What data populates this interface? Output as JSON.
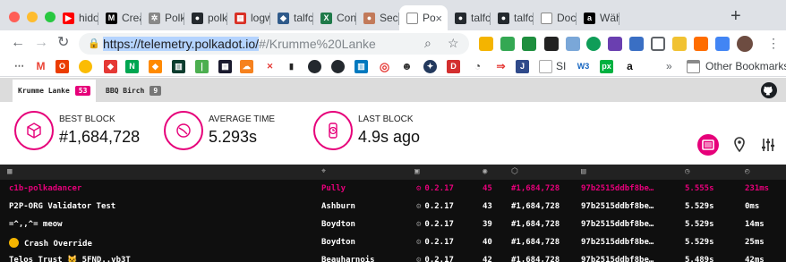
{
  "browser": {
    "tabs": [
      {
        "label": "hidon",
        "favicon": "youtube-icon",
        "color": "#ff0000",
        "glyph": "▶"
      },
      {
        "label": "Creat",
        "favicon": "medium-icon",
        "color": "#000000",
        "glyph": "M"
      },
      {
        "label": "Polka",
        "favicon": "polkadot-icon",
        "color": "#888888",
        "glyph": "✲"
      },
      {
        "label": "polka",
        "favicon": "github-icon",
        "color": "#24292e",
        "glyph": "●"
      },
      {
        "label": "logwa",
        "favicon": "logwatch-icon",
        "color": "#d93025",
        "glyph": "▦"
      },
      {
        "label": "talfco",
        "favicon": "gitlab-icon",
        "color": "#2f5a8a",
        "glyph": "◆"
      },
      {
        "label": "Confi",
        "favicon": "confluence-icon",
        "color": "#1f7a4a",
        "glyph": "X"
      },
      {
        "label": "Secur",
        "favicon": "user-icon",
        "color": "#c27a5a",
        "glyph": "●"
      },
      {
        "label": "Po",
        "favicon": "page-icon",
        "color": "#ffffff",
        "glyph": ""
      },
      {
        "label": "talfco",
        "favicon": "github-icon",
        "color": "#24292e",
        "glyph": "●"
      },
      {
        "label": "talfco",
        "favicon": "github-icon",
        "color": "#24292e",
        "glyph": "●"
      },
      {
        "label": "Dock",
        "favicon": "page-icon",
        "color": "#ffffff",
        "glyph": ""
      },
      {
        "label": "Wähl",
        "favicon": "amazon-icon",
        "color": "#000000",
        "glyph": "a"
      }
    ],
    "active_tab_index": 8,
    "url_selected": "https://telemetry.polkadot.io/",
    "url_rest": "#/Krumme%20Lanke",
    "other_bookmarks": "Other Bookmarks",
    "bookmark_chevron": "»",
    "bookmark_labels": {
      "si": "SI"
    }
  },
  "telemetry": {
    "chains": [
      {
        "name": "Krumme Lanke",
        "count": "53",
        "color": "#e6007a"
      },
      {
        "name": "BBQ Birch",
        "count": "9",
        "color": "#777777"
      }
    ],
    "stats": {
      "best_block_label": "BEST BLOCK",
      "best_block": "#1,684,728",
      "average_time_label": "AVERAGE TIME",
      "average_time": "5.293s",
      "last_block_label": "LAST BLOCK",
      "last_block": "4.9s ago"
    },
    "rows": [
      {
        "name": "c1b-polkadancer",
        "location": "Pully",
        "version": "0.2.17",
        "peers": "45",
        "block": "#1,684,728",
        "hash": "97b2515ddbf8be…",
        "block_time": "5.555s",
        "propagation": "231ms",
        "highlight": true
      },
      {
        "name": "P2P-ORG Validator Test",
        "location": "Ashburn",
        "version": "0.2.17",
        "peers": "43",
        "block": "#1,684,728",
        "hash": "97b2515ddbf8be…",
        "block_time": "5.529s",
        "propagation": "0ms",
        "highlight": false
      },
      {
        "name": "=^,,^= meow",
        "location": "Boydton",
        "version": "0.2.17",
        "peers": "39",
        "block": "#1,684,728",
        "hash": "97b2515ddbf8be…",
        "block_time": "5.529s",
        "propagation": "14ms",
        "highlight": false
      },
      {
        "name": "Crash Override",
        "location": "Boydton",
        "version": "0.2.17",
        "peers": "40",
        "block": "#1,684,728",
        "hash": "97b2515ddbf8be…",
        "block_time": "5.529s",
        "propagation": "25ms",
        "highlight": false
      },
      {
        "name": "Telos Trust 🐱 5FND..vb3T",
        "location": "Beauharnois",
        "version": "0.2.17",
        "peers": "42",
        "block": "#1,684,728",
        "hash": "97b2515ddbf8be…",
        "block_time": "5.489s",
        "propagation": "42ms",
        "highlight": false
      }
    ],
    "colors": {
      "accent": "#e6007a",
      "table_bg": "#0f0f0f",
      "header_bg": "#222222"
    }
  }
}
